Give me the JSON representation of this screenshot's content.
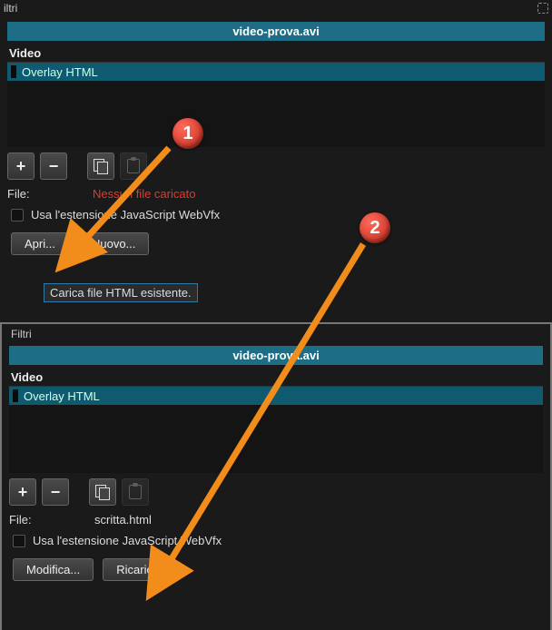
{
  "top": {
    "panel_title": "iltri",
    "clip_name": "video-prova.avi",
    "track_label": "Video",
    "filter_name": "Overlay HTML",
    "file_label": "File:",
    "file_status": "Nessun file caricato",
    "webvfx_label": "Usa l'estensione JavaScript WebVfx",
    "btn_open": "Apri...",
    "btn_new": "Nuovo...",
    "tooltip": "Carica file HTML esistente."
  },
  "bottom": {
    "panel_title": "Filtri",
    "clip_name": "video-prova.avi",
    "track_label": "Video",
    "filter_name": "Overlay HTML",
    "file_label": "File:",
    "file_status": "scritta.html",
    "webvfx_label": "Usa l'estensione JavaScript WebVfx",
    "btn_edit": "Modifica...",
    "btn_reload": "Ricarica"
  },
  "annotations": {
    "badge1": "1",
    "badge2": "2"
  }
}
